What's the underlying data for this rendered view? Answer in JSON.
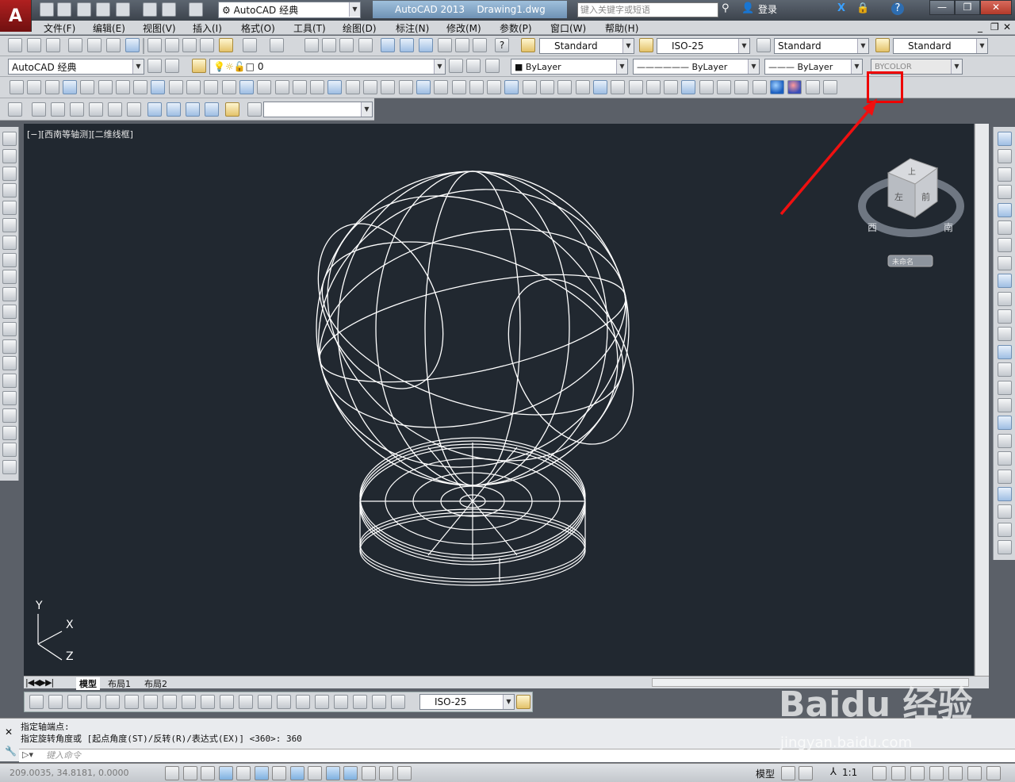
{
  "titlebar": {
    "logo": "A",
    "workspace": "AutoCAD 经典",
    "app_title": "AutoCAD 2013",
    "drawing_name": "Drawing1.dwg",
    "search_placeholder": "键入关键字或短语",
    "login": "登录",
    "help": "?"
  },
  "menubar": {
    "items": [
      "文件(F)",
      "编辑(E)",
      "视图(V)",
      "插入(I)",
      "格式(O)",
      "工具(T)",
      "绘图(D)",
      "标注(N)",
      "修改(M)",
      "参数(P)",
      "窗口(W)",
      "帮助(H)"
    ]
  },
  "styles_toolbar": {
    "text_style": "Standard",
    "dim_style": "ISO-25",
    "table_style": "Standard",
    "multileader_style": "Standard"
  },
  "layers_toolbar": {
    "workspace": "AutoCAD 经典",
    "current_layer": "0",
    "color": "ByLayer",
    "linetype": "ByLayer",
    "lineweight": "ByLayer",
    "plot_style": "BYCOLOR"
  },
  "viewport": {
    "label": "[−][西南等轴测][二维线框]",
    "ucs": {
      "x": "X",
      "y": "Y",
      "z": "Z"
    },
    "viewcube": {
      "top_face": "上",
      "left_face": "左",
      "front_face": "前",
      "compass_w": "西",
      "compass_s": "南",
      "ucs_menu": "未命名"
    }
  },
  "layout_tabs": [
    "模型",
    "布局1",
    "布局2"
  ],
  "dim_toolbar": {
    "dim_style": "ISO-25"
  },
  "command": {
    "history": [
      "指定轴端点:",
      "指定旋转角度或 [起点角度(ST)/反转(R)/表达式(EX)] <360>: 360"
    ],
    "input_placeholder": "键入命令"
  },
  "statusbar": {
    "coordinates": "209.0035, 34.8181, 0.0000",
    "model_label": "模型",
    "annotation_scale": "1:1"
  },
  "annotation": {
    "highlight_color": "#e00000",
    "target": "rendered-sphere-icon"
  },
  "watermark": {
    "text": "Baidu 经验",
    "url_text": "jingyan.baidu.com"
  },
  "colors": {
    "viewport_bg": "#212830",
    "wireframe": "#ffffff",
    "chrome": "#d4d7db"
  }
}
